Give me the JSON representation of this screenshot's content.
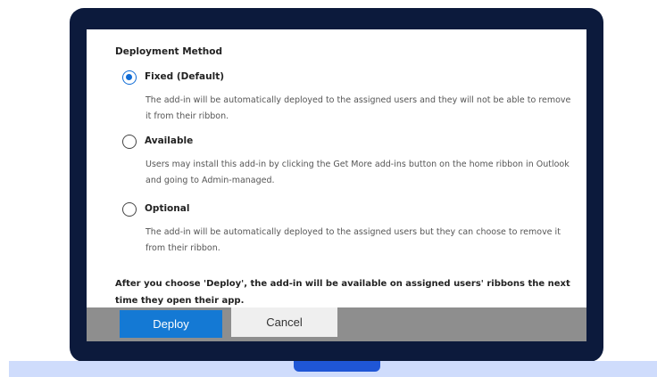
{
  "deployment": {
    "section_title": "Deployment Method",
    "options": [
      {
        "label": "Fixed (Default)",
        "selected": true,
        "description": "The add-in will be automatically deployed to the assigned users and they will not be able to remove it from their ribbon."
      },
      {
        "label": "Available",
        "selected": false,
        "description": "Users may install this add-in by clicking the Get More add-ins button on the home ribbon in Outlook and going to Admin-managed."
      },
      {
        "label": "Optional",
        "selected": false,
        "description": "The add-in will be automatically deployed to the assigned users but they can choose to remove it from their ribbon."
      }
    ],
    "notice": "After you choose 'Deploy', the add-in will be available on assigned users' ribbons the next time they open their app."
  },
  "footer": {
    "deploy_label": "Deploy",
    "cancel_label": "Cancel"
  },
  "colors": {
    "accent": "#0f6cd6",
    "deploy_button": "#1479d4",
    "bezel": "#0c1a3c",
    "base": "#cfdcfc",
    "notch": "#1f56d6"
  }
}
